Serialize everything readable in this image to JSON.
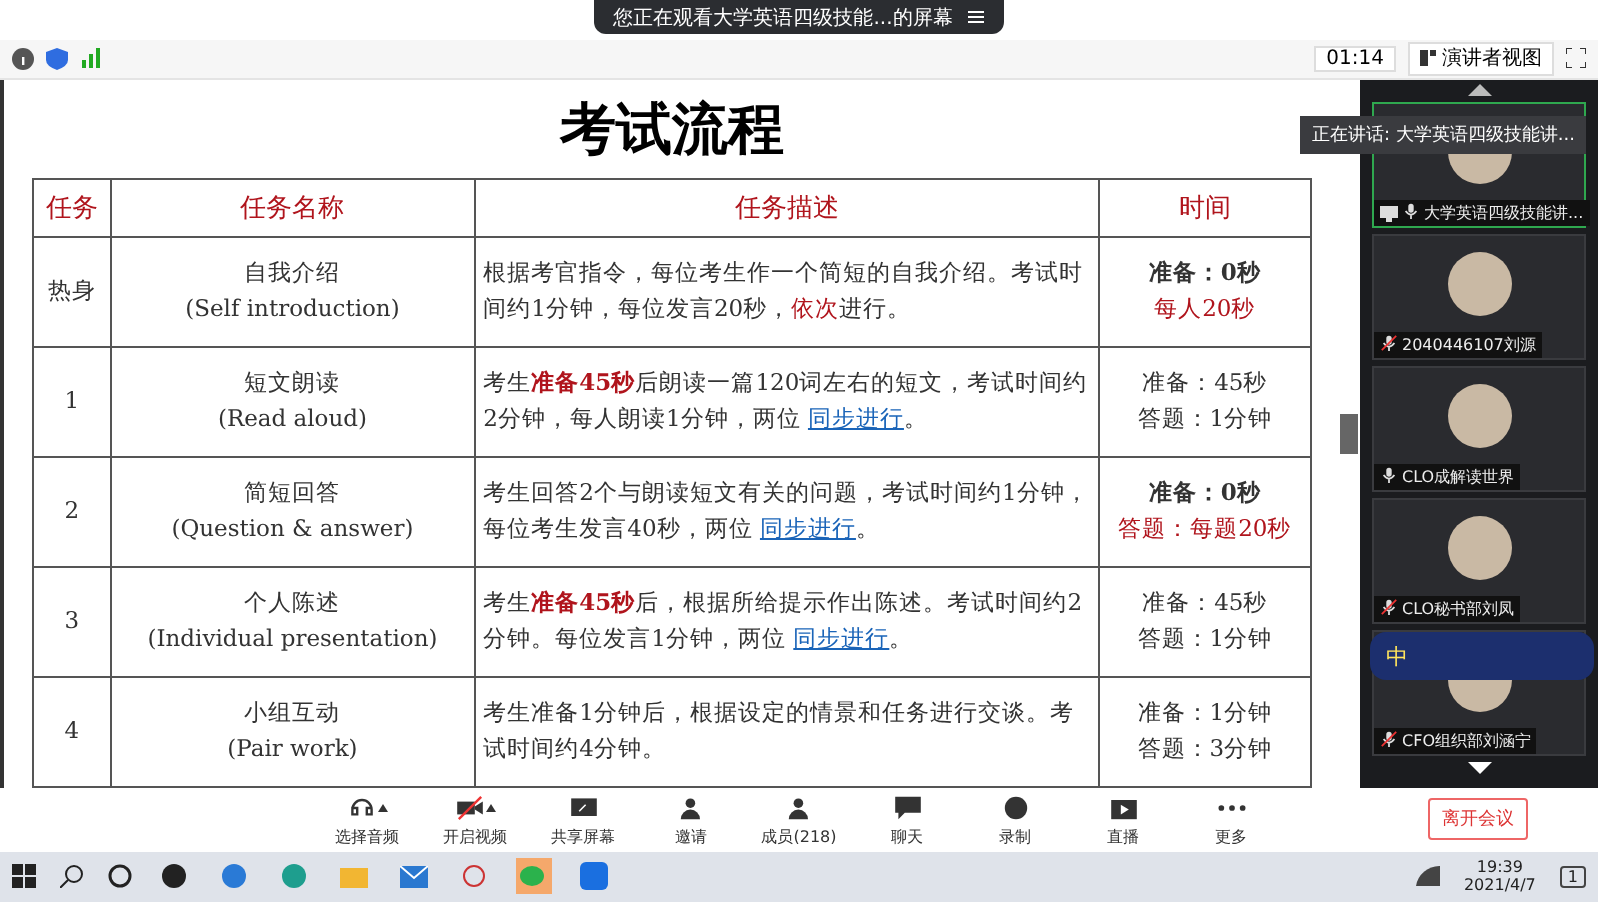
{
  "top_bar": {
    "viewing_title": "您正在观看大学英语四级技能...的屏幕"
  },
  "toolbar": {
    "timer": "01:14",
    "view_mode": "演讲者视图"
  },
  "slide": {
    "title": "考试流程",
    "columns": [
      "任务",
      "任务名称",
      "任务描述",
      "时间"
    ],
    "rows": [
      {
        "task": "热身",
        "name": "自我介绍",
        "name_en": "(Self introduction)",
        "description": [
          {
            "kind": "plain",
            "text": "根据考官指令，每位考生作一个简短的自我介绍。考试时间约1分钟，每位发言20秒，"
          },
          {
            "kind": "emphasis",
            "text": "依次"
          },
          {
            "kind": "plain",
            "text": "进行。"
          }
        ],
        "time": [
          {
            "kind": "bold",
            "text": "准备：0秒"
          },
          {
            "kind": "red",
            "text": "每人20秒"
          }
        ]
      },
      {
        "task": "1",
        "name": "短文朗读",
        "name_en": "(Read aloud)",
        "description": [
          {
            "kind": "plain",
            "text": "考生"
          },
          {
            "kind": "strong",
            "text": "准备45秒"
          },
          {
            "kind": "plain",
            "text": "后朗读一篇120词左右的短文，考试时间约2分钟，每人朗读1分钟，两位 "
          },
          {
            "kind": "link",
            "text": "同步进行"
          },
          {
            "kind": "plain",
            "text": "。"
          }
        ],
        "time": [
          {
            "kind": "plain",
            "text": "准备：45秒"
          },
          {
            "kind": "plain",
            "text": "答题：1分钟"
          }
        ]
      },
      {
        "task": "2",
        "name": "简短回答",
        "name_en": "(Question & answer)",
        "description": [
          {
            "kind": "plain",
            "text": "考生回答2个与朗读短文有关的问题，考试时间约1分钟，每位考生发言40秒，两位 "
          },
          {
            "kind": "link",
            "text": "同步进行"
          },
          {
            "kind": "plain",
            "text": "。"
          }
        ],
        "time": [
          {
            "kind": "bold",
            "text": "准备：0秒"
          },
          {
            "kind": "red",
            "text": "答题：每题20秒"
          }
        ]
      },
      {
        "task": "3",
        "name": "个人陈述",
        "name_en": "(Individual presentation)",
        "description": [
          {
            "kind": "plain",
            "text": "考生"
          },
          {
            "kind": "strong",
            "text": "准备45秒"
          },
          {
            "kind": "plain",
            "text": "后，根据所给提示作出陈述。考试时间约2分钟。每位发言1分钟，两位 "
          },
          {
            "kind": "link",
            "text": "同步进行"
          },
          {
            "kind": "plain",
            "text": "。"
          }
        ],
        "time": [
          {
            "kind": "plain",
            "text": "准备：45秒"
          },
          {
            "kind": "plain",
            "text": "答题：1分钟"
          }
        ]
      },
      {
        "task": "4",
        "name": "小组互动",
        "name_en": "(Pair work)",
        "description": [
          {
            "kind": "plain",
            "text": "考生准备1分钟后，根据设定的情景和任务进行交谈。考试时间约4分钟。"
          }
        ],
        "time": [
          {
            "kind": "plain",
            "text": "准备：1分钟"
          },
          {
            "kind": "plain",
            "text": "答题：3分钟"
          }
        ]
      }
    ]
  },
  "speaker_tooltip": "正在讲话: 大学英语四级技能讲...",
  "participants": [
    {
      "name": "大学英语四级技能讲...",
      "speaking": true,
      "muted": false,
      "sharing": true
    },
    {
      "name": "2040446107刘源",
      "speaking": false,
      "muted": true,
      "sharing": false
    },
    {
      "name": "CLO成解读世界",
      "speaking": false,
      "muted": false,
      "sharing": false
    },
    {
      "name": "CLO秘书部刘凤",
      "speaking": false,
      "muted": true,
      "sharing": false
    },
    {
      "name": "CFO组织部刘涵宁",
      "speaking": false,
      "muted": true,
      "sharing": false
    }
  ],
  "ime_bar": {
    "mode": "中"
  },
  "meeting_controls": [
    {
      "kind": "headset",
      "label": "选择音频",
      "caret": true
    },
    {
      "kind": "video-off",
      "label": "开启视频",
      "caret": true
    },
    {
      "kind": "share",
      "label": "共享屏幕",
      "caret": false
    },
    {
      "kind": "invite",
      "label": "邀请",
      "caret": false
    },
    {
      "kind": "members",
      "label": "成员(218)",
      "caret": false
    },
    {
      "kind": "chat",
      "label": "聊天",
      "caret": false
    },
    {
      "kind": "record",
      "label": "录制",
      "caret": false
    },
    {
      "kind": "live",
      "label": "直播",
      "caret": false
    },
    {
      "kind": "more",
      "label": "更多",
      "caret": false
    }
  ],
  "leave_button": "离开会议",
  "taskbar": {
    "time": "19:39",
    "date": "2021/4/7",
    "notifications": "1"
  }
}
